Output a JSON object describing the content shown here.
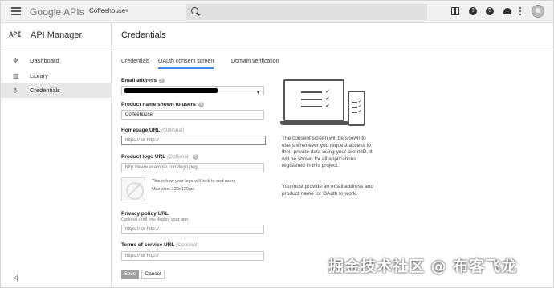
{
  "topbar": {
    "logo": "Google APIs",
    "project": "Coffeehouse",
    "icons": [
      "menu-icon",
      "dropdown-caret-icon",
      "search-icon",
      "gift-icon",
      "alert-icon",
      "help-icon",
      "notifications-icon",
      "more-icon",
      "avatar"
    ]
  },
  "sidebar": {
    "mark": "API",
    "title": "API Manager",
    "items": [
      {
        "label": "Dashboard",
        "icon": "dashboard-icon",
        "active": false
      },
      {
        "label": "Library",
        "icon": "library-icon",
        "active": false
      },
      {
        "label": "Credentials",
        "icon": "key-icon",
        "active": true
      }
    ],
    "collapse": "<|"
  },
  "main": {
    "title": "Credentials",
    "tabs": [
      {
        "label": "Credentials",
        "active": false
      },
      {
        "label": "OAuth consent screen",
        "active": true
      },
      {
        "label": "Domain verification",
        "active": false
      }
    ]
  },
  "form": {
    "email_label": "Email address",
    "product_label": "Product name shown to users",
    "product_value": "Coffeehouse",
    "homepage_label": "Homepage URL",
    "homepage_optional": "(Optional)",
    "homepage_placeholder": "https:// or http://",
    "logo_label": "Product logo URL",
    "logo_optional": "(Optional)",
    "logo_placeholder": "http://www.example.com/logo.png",
    "logo_hint1": "This is how your logo will look to end users",
    "logo_hint2": "Max size: 120x120 px",
    "privacy_label": "Privacy policy URL",
    "privacy_sub": "Optional until you deploy your app",
    "privacy_placeholder": "https:// or http://",
    "tos_label": "Terms of service URL",
    "tos_optional": "(Optional)",
    "tos_placeholder": "https:// or http://",
    "save": "Save",
    "cancel": "Cancel"
  },
  "info": {
    "para1": "The consent screen will be shown to users whenever you request access to their private data using your client ID. It will be shown for all applications registered in this project.",
    "para2": "You must provide an email address and product name for OAuth to work."
  },
  "watermark": "掘金技术社区 @ 布客飞龙"
}
